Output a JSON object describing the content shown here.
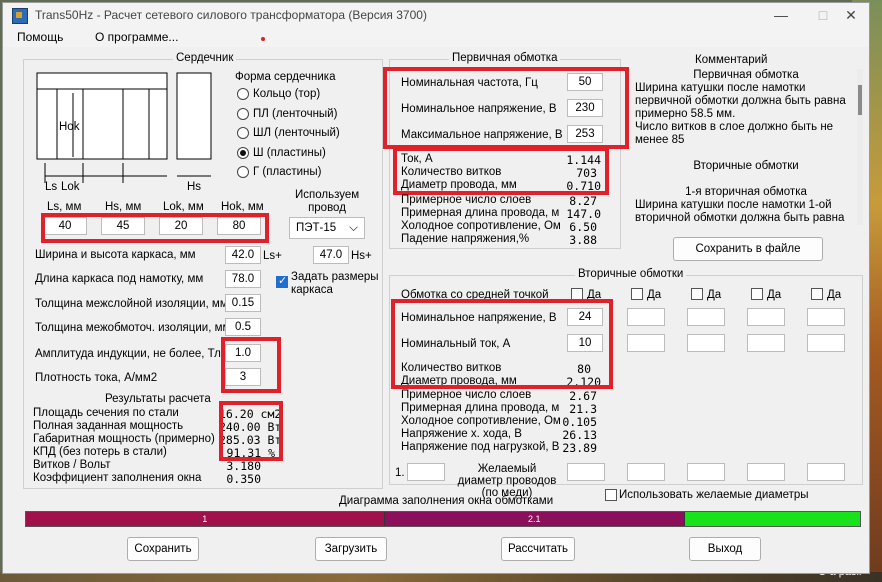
{
  "window": {
    "title": "Trans50Hz - Расчет сетевого силового трансформатора (Версия 3700)",
    "minimize": "—",
    "maximize": "□",
    "close": "✕"
  },
  "menu": {
    "help": "Помощь",
    "about": "О программе..."
  },
  "core": {
    "title": "Сердечник",
    "diagram": {
      "hok": "Hok",
      "lok": "Lok",
      "ls": "Ls",
      "hs": "Hs"
    },
    "shape_title": "Форма сердечника",
    "shapes": [
      "Кольцо  (тор)",
      "ПЛ  (ленточный)",
      "ШЛ  (ленточный)",
      "Ш  (пластины)",
      "Г (пластины)"
    ],
    "selected_shape_index": 3,
    "dim_headers": [
      "Ls, мм",
      "Hs, мм",
      "Lok, мм",
      "Hok, мм"
    ],
    "dim_values": [
      "40",
      "45",
      "20",
      "80"
    ],
    "wire_label": "Используем провод",
    "wire_value": "ПЭТ-15"
  },
  "frame": {
    "width_height_label": "Ширина и высота каркаса, мм",
    "width_value": "42.0",
    "ls_plus": "Ls+",
    "height_value": "47.0",
    "hs_plus": "Hs+",
    "length_label": "Длина каркаса под намотку, мм",
    "length_value": "78.0",
    "set_sizes_label": "Задать размеры каркаса",
    "set_sizes_checked": true,
    "interlayer_label": "Толщина межслойной изоляции, мм",
    "interlayer_value": "0.15",
    "interwinding_label": "Толщина межобмоточ. изоляции, мм",
    "interwinding_value": "0.5",
    "induction_label": "Амплитуда индукции, не более, Тл",
    "induction_value": "1.0",
    "current_density_label": "Плотность тока, А/мм2",
    "current_density_value": "3"
  },
  "results": {
    "title": "Результаты расчета",
    "rows": [
      {
        "label": "Площадь сечения по стали",
        "value": "16.20 см2"
      },
      {
        "label": "Полная заданная мощность",
        "value": "240.00 Вт"
      },
      {
        "label": "Габаритная мощность (примерно)",
        "value": "285.03 Вт"
      },
      {
        "label": "КПД (без потерь в стали)",
        "value": "91.31 %"
      },
      {
        "label": "Витков / Вольт",
        "value": "3.180"
      },
      {
        "label": "Коэффициент заполнения окна",
        "value": "0.350"
      }
    ]
  },
  "primary": {
    "title": "Первичная обмотка",
    "freq_label": "Номинальная частота, Гц",
    "freq_value": "50",
    "voltage_label": "Номинальное напряжение, В",
    "voltage_value": "230",
    "max_voltage_label": "Максимальное напряжение, В",
    "max_voltage_value": "253",
    "rows": [
      {
        "label": "Ток, А",
        "value": "1.144"
      },
      {
        "label": "Количество витков",
        "value": "703"
      },
      {
        "label": "Диаметр провода, мм",
        "value": "0.710"
      },
      {
        "label": "Примерное число слоев",
        "value": "8.27"
      },
      {
        "label": "Примерная длина провода, м",
        "value": "147.0"
      },
      {
        "label": "Холодное сопротивление, Ом",
        "value": "6.50"
      },
      {
        "label": "Падение напряжения,%",
        "value": "3.88"
      }
    ]
  },
  "comment": {
    "title": "Комментарий",
    "lines": [
      "Первичная обмотка",
      "Ширина катушки после намотки",
      "первичной обмотки должна быть равна",
      "примерно 58.5 мм.",
      "Число витков в слое должно быть не",
      "менее 85",
      "",
      "Вторичные обмотки",
      "",
      "1-я вторичная обмотка",
      "Ширина катушки после намотки 1-ой",
      "вторичной обмотки должна быть равна"
    ],
    "save_button": "Сохранить в файле"
  },
  "secondary": {
    "title": "Вторичные обмотки",
    "center_tap_label": "Обмотка со средней точкой",
    "yes": "Да",
    "voltage_label": "Номинальное напряжение, В",
    "voltage_value": "24",
    "current_label": "Номинальный ток, А",
    "current_value": "10",
    "rows": [
      {
        "label": "Количество витков",
        "value": "80"
      },
      {
        "label": "Диаметр провода, мм",
        "value": "2.120"
      },
      {
        "label": "Примерное число слоев",
        "value": "2.67"
      },
      {
        "label": "Примерная длина провода, м",
        "value": "21.3"
      },
      {
        "label": "Холодное сопротивление, Ом",
        "value": "0.105"
      },
      {
        "label": "Напряжение х. хода, В",
        "value": "26.13"
      },
      {
        "label": "Напряжение под нагрузкой, В",
        "value": "23.89"
      }
    ],
    "desired_index": "1.",
    "desired_label": "Желаемый диаметр проводов  (по меди)",
    "use_desired_label": "Использовать желаемые диаметры"
  },
  "fill_diagram": {
    "title": "Диаграмма заполнения окна обмотками",
    "segments": [
      {
        "label": "1",
        "fraction": 0.43,
        "color": "#a0104a"
      },
      {
        "label": "2.1",
        "fraction": 0.36,
        "color": "#8b0f5a"
      },
      {
        "label": "",
        "fraction": 0.21,
        "color": "#17e21a"
      }
    ]
  },
  "buttons": {
    "save": "Сохранить",
    "load": "Загрузить",
    "calculate": "Рассчитать",
    "exit": "Выход"
  },
  "desktop_corner_text": "Ö a pasli"
}
